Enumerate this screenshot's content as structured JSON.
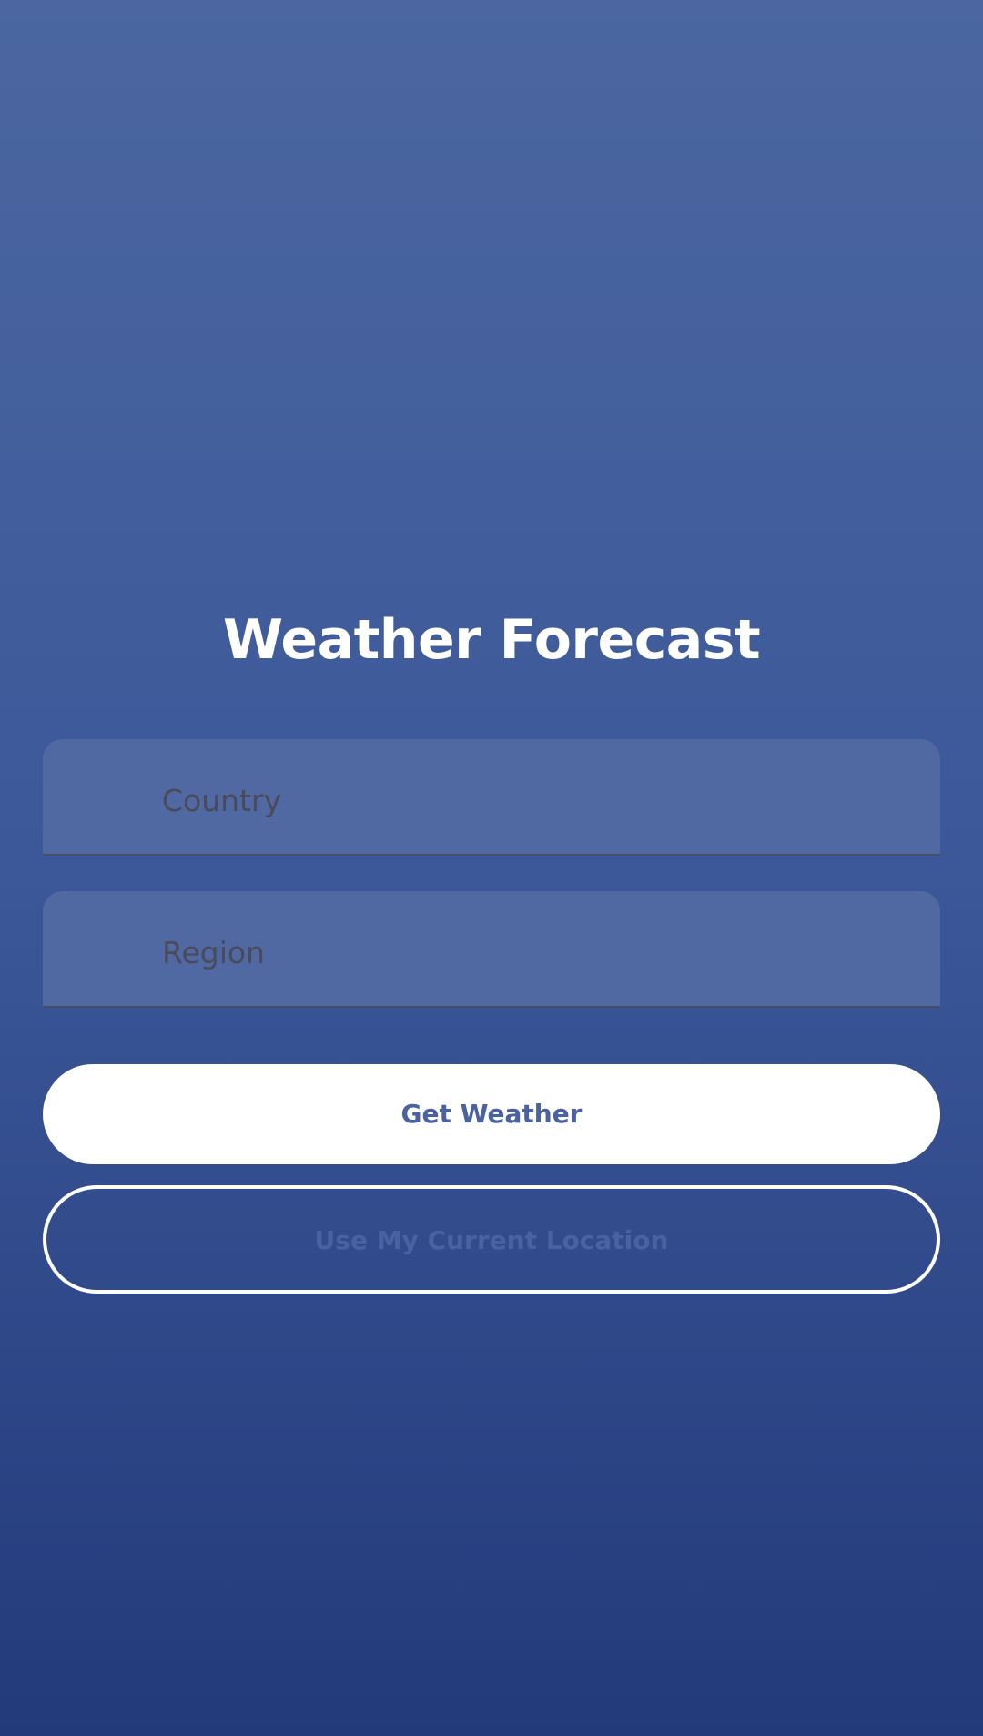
{
  "app": {
    "title": "Weather Forecast"
  },
  "form": {
    "country_placeholder": "Country",
    "region_placeholder": "Region"
  },
  "actions": {
    "get_weather_label": "Get Weather",
    "use_location_label": "Use My Current Location"
  },
  "colors": {
    "background_top": "#4b66a0",
    "background_bottom": "#233a7a",
    "field_fill": "#5069a3",
    "primary_button_bg": "#ffffff",
    "button_text": "#4a62a0"
  }
}
